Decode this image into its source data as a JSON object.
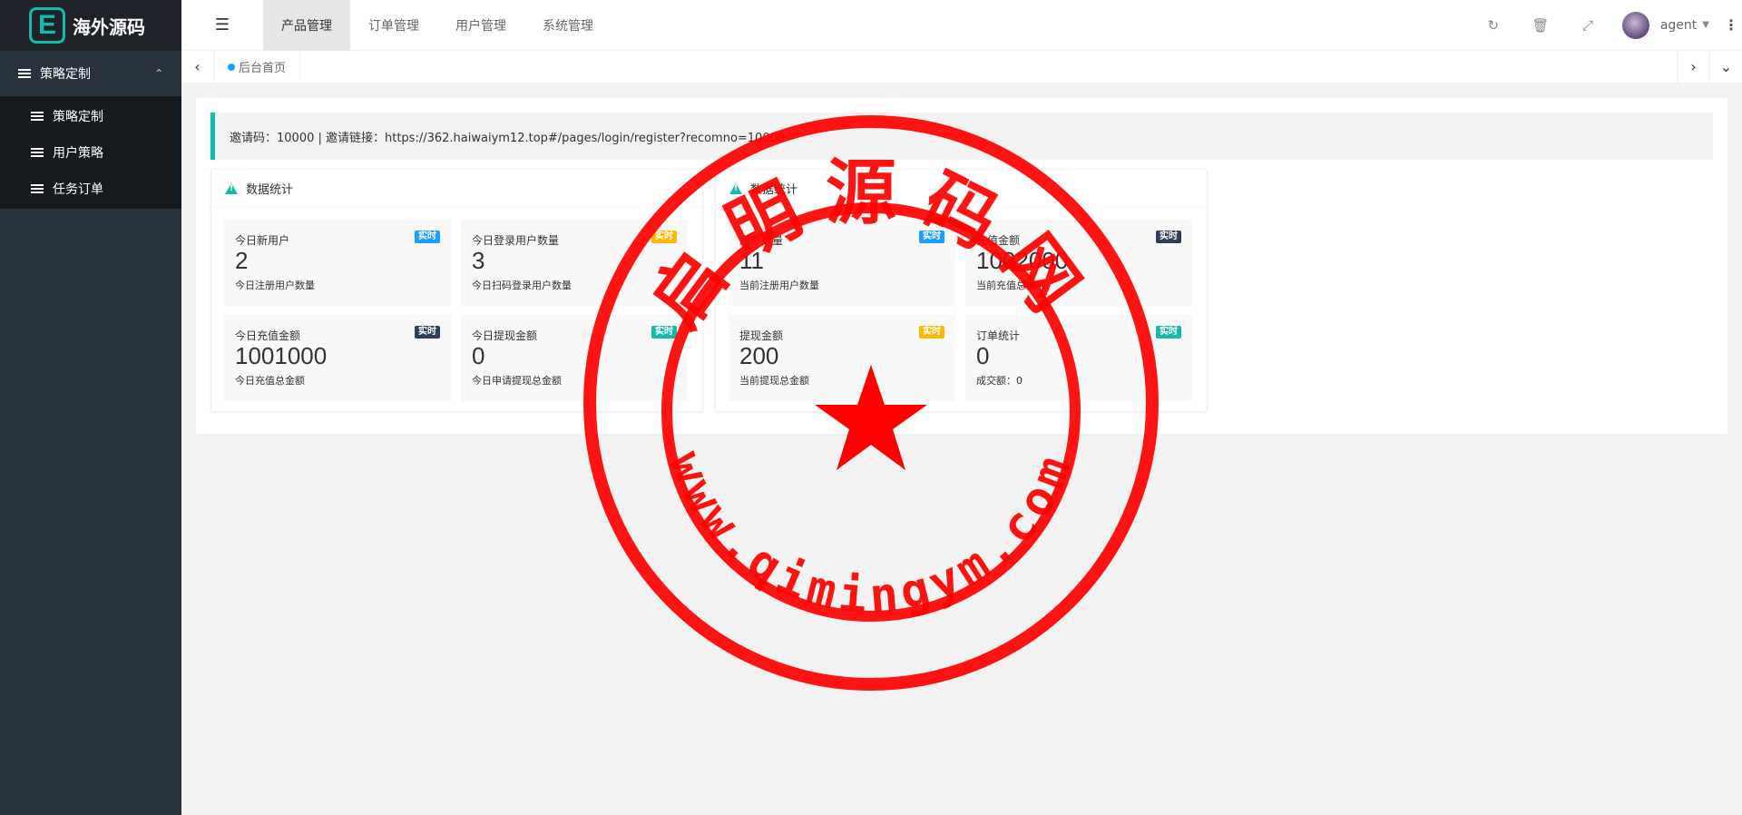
{
  "logo": {
    "mark": "E",
    "title": "海外源码"
  },
  "sidebar": {
    "group": {
      "label": "策略定制"
    },
    "items": [
      {
        "label": "策略定制"
      },
      {
        "label": "用户策略"
      },
      {
        "label": "任务订单"
      }
    ]
  },
  "header": {
    "nav": [
      {
        "label": "产品管理"
      },
      {
        "label": "订单管理"
      },
      {
        "label": "用户管理"
      },
      {
        "label": "系统管理"
      }
    ],
    "username": "agent"
  },
  "tabs": {
    "home": "后台首页"
  },
  "invite": {
    "text": "邀请码：10000 | 邀请链接：https://362.haiwaiym12.top#/pages/login/register?recomno=10000"
  },
  "cards": [
    {
      "title": "数据统计",
      "stats": [
        {
          "label": "今日新用户",
          "value": "2",
          "sub": "今日注册用户数量",
          "badge": "实时",
          "badge_color": "#1e9fff"
        },
        {
          "label": "今日登录用户数量",
          "value": "3",
          "sub": "今日扫码登录用户数量",
          "badge": "实时",
          "badge_color": "#ffb800"
        },
        {
          "label": "今日充值金额",
          "value": "1001000",
          "sub": "今日充值总金额",
          "badge": "实时",
          "badge_color": "#2f4056"
        },
        {
          "label": "今日提现金额",
          "value": "0",
          "sub": "今日申请提现总金额",
          "badge": "实时",
          "badge_color": "#16baaa"
        }
      ]
    },
    {
      "title": "数据统计",
      "stats": [
        {
          "label": "用户数量",
          "value": "11",
          "sub": "当前注册用户数量",
          "badge": "实时",
          "badge_color": "#1e9fff"
        },
        {
          "label": "充值金额",
          "value": "1002000",
          "sub": "当前充值总金额",
          "badge": "实时",
          "badge_color": "#2f4056"
        },
        {
          "label": "提现金额",
          "value": "200",
          "sub": "当前提现总金额",
          "badge": "实时",
          "badge_color": "#ffb800"
        },
        {
          "label": "订单统计",
          "value": "0",
          "sub": "成交额：0",
          "badge": "实时",
          "badge_color": "#16baaa"
        }
      ]
    }
  ],
  "watermark": {
    "top_text": "启明源码网",
    "bottom_text": "www.qimingym.com",
    "color": "#ff0000"
  }
}
